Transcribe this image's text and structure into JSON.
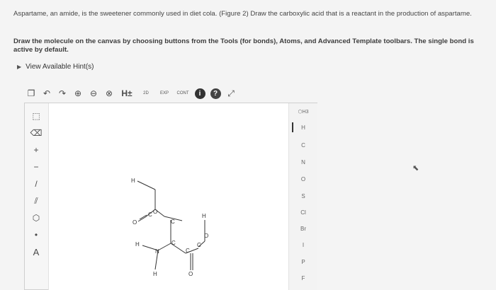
{
  "question": "Aspartame, an amide, is the sweetener commonly used in diet cola. (Figure 2) Draw the carboxylic acid that is a reactant in the production of aspartame.",
  "instruction": "Draw the molecule on the canvas by choosing buttons from the Tools (for bonds), Atoms, and Advanced Template toolbars. The single bond is active by default.",
  "hint_link": "View Available Hint(s)",
  "toolbar": [
    {
      "name": "template-icon",
      "glyph": "❐"
    },
    {
      "name": "undo-icon",
      "glyph": "↶"
    },
    {
      "name": "redo-icon",
      "glyph": "↷"
    },
    {
      "name": "zoom-in-icon",
      "glyph": "⊕"
    },
    {
      "name": "zoom-out-icon",
      "glyph": "⊖"
    },
    {
      "name": "clear-icon",
      "glyph": "⊗"
    },
    {
      "name": "explicit-hydrogens-button",
      "glyph": "H±"
    },
    {
      "name": "2d-button",
      "glyph": "2D"
    },
    {
      "name": "exact-button",
      "glyph": "EXP"
    },
    {
      "name": "cont-button",
      "glyph": "CONT"
    },
    {
      "name": "info-icon",
      "glyph": "i"
    },
    {
      "name": "help-icon",
      "glyph": "?"
    },
    {
      "name": "fullscreen-icon",
      "glyph": "⤢"
    }
  ],
  "left_tools": [
    {
      "name": "select-tool-icon",
      "glyph": "⬚"
    },
    {
      "name": "eraser-tool-icon",
      "glyph": "⌫"
    },
    {
      "name": "plus-charge-icon",
      "glyph": "+"
    },
    {
      "name": "minus-charge-icon",
      "glyph": "−"
    },
    {
      "name": "single-bond-icon",
      "glyph": "/"
    },
    {
      "name": "double-bond-icon",
      "glyph": "⫽"
    },
    {
      "name": "ring-template-icon",
      "glyph": "⬡"
    },
    {
      "name": "lone-pair-icon",
      "glyph": "•"
    },
    {
      "name": "atom-label-icon",
      "glyph": "A"
    }
  ],
  "atoms": [
    {
      "symbol": "⬡H3"
    },
    {
      "symbol": "H"
    },
    {
      "symbol": "C"
    },
    {
      "symbol": "N"
    },
    {
      "symbol": "O"
    },
    {
      "symbol": "S"
    },
    {
      "symbol": "Cl"
    },
    {
      "symbol": "Br"
    },
    {
      "symbol": "I"
    },
    {
      "symbol": "P"
    },
    {
      "symbol": "F"
    }
  ],
  "molecule": {
    "atoms": [
      {
        "label": "H"
      },
      {
        "label": "O"
      },
      {
        "label": "C"
      },
      {
        "label": "O"
      },
      {
        "label": "C"
      },
      {
        "label": "H"
      },
      {
        "label": "N"
      },
      {
        "label": "H"
      },
      {
        "label": "C"
      },
      {
        "label": "C"
      },
      {
        "label": "O"
      },
      {
        "label": "C"
      },
      {
        "label": "O"
      },
      {
        "label": "H"
      }
    ]
  }
}
